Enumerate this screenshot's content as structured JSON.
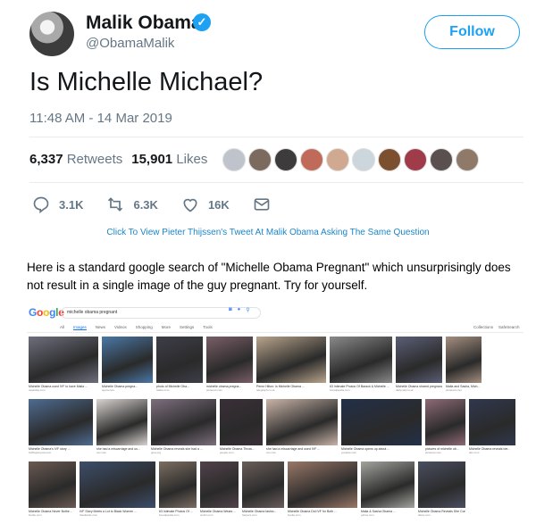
{
  "tweet": {
    "name": "Malik Obama",
    "handle": "@ObamaMalik",
    "follow_label": "Follow",
    "text": "Is Michelle Michael?",
    "timestamp": "11:48 AM - 14 Mar 2019",
    "retweets_count": "6,337",
    "retweets_label": "Retweets",
    "likes_count": "15,901",
    "likes_label": "Likes",
    "replies": "3.1K",
    "retweets_short": "6.3K",
    "likes_short": "16K"
  },
  "click_note": "Click To View Pieter Thijssen's Tweet At Malik Obama Asking The Same Question",
  "body_text": "Here is a standard google search of \"Michelle Obama Pregnant\" which unsurprisingly does not result in a single image of the guy pregnant. Try for yourself.",
  "google": {
    "logo": "Google",
    "query": "michelle obama pregnant",
    "tabs": [
      "All",
      "Images",
      "News",
      "Videos",
      "Shopping",
      "More",
      "Settings",
      "Tools"
    ],
    "right_links": [
      "Collections",
      "SafeSearch"
    ],
    "rows": [
      [
        {
          "caption": "Michelle Obama used IVF to have Malia ...",
          "source": "usatoday.com",
          "color": "#6d6f7d"
        },
        {
          "caption": "Michelle Obama pregna...",
          "source": "quora.com",
          "color": "#4a78a6"
        },
        {
          "caption": "photo of Michelle Oba...",
          "source": "twitter.com",
          "color": "#3e3e4a"
        },
        {
          "caption": "michelle obama pregna...",
          "source": "pinterest.com",
          "color": "#7a5f68"
        },
        {
          "caption": "Perez Hilton: Is Michelle Obama ...",
          "source": "telegraph.co.uk",
          "color": "#b9a58c"
        },
        {
          "caption": "63 Intimate Photos Of Barack & Michelle ...",
          "source": "boredpanda.com",
          "color": "#8a8a8a"
        },
        {
          "caption": "Michelle Obama shared pregnancy tips ...",
          "source": "dailymail.co.uk",
          "color": "#5b5f77"
        },
        {
          "caption": "Malia and Sasha, Mich...",
          "source": "pinterest.com",
          "color": "#a58f80"
        }
      ],
      [
        {
          "caption": "Michelle Obama's IVF story ...",
          "source": "huffingtonpost.com",
          "color": "#4f6c92"
        },
        {
          "caption": "she had a miscarriage and us...",
          "source": "vox.com",
          "color": "#d8d3d0"
        },
        {
          "caption": "Michelle Obama reveals she had a ...",
          "source": "gma.org",
          "color": "#7d6f7e"
        },
        {
          "caption": "Michelle Obama Throw...",
          "source": "people.com",
          "color": "#3a2f38"
        },
        {
          "caption": "she had a miscarriage and used IVF ...",
          "source": "vox.com",
          "color": "#c9b4a8"
        },
        {
          "caption": "Michelle Obama opens up about ...",
          "source": "youtube.com",
          "color": "#223049"
        },
        {
          "caption": "pictures of michelle ob...",
          "source": "pinterest.com",
          "color": "#8e6a76"
        },
        {
          "caption": "Michelle Obama reveals ber...",
          "source": "abc.com",
          "color": "#30384f"
        }
      ],
      [
        {
          "caption": "Michelle Obama Never Bothe...",
          "source": "bustle.com",
          "color": "#6b5a52"
        },
        {
          "caption": "IVF Story Meets a Lot to Black Women ...",
          "source": "theatlantic.com",
          "color": "#3c4e6a"
        },
        {
          "caption": "63 Intimate Photos Of ...",
          "source": "boredpanda.com",
          "color": "#7c6e62"
        },
        {
          "caption": "Michelle Obama Wears ...",
          "source": "wmbz.com",
          "color": "#52424a"
        },
        {
          "caption": "Michelle Obama fashio...",
          "source": "harpers.com",
          "color": "#6a5e5a"
        },
        {
          "caption": "Michelle Obama Did IVF for Both ...",
          "source": "bustle.com",
          "color": "#9a7868"
        },
        {
          "caption": "Malia & Sasha Obama ...",
          "source": "yahoo.com",
          "color": "#a3a39e"
        },
        {
          "caption": "Michelle Obama Reveals She Conceived ...",
          "source": "allure.com",
          "color": "#4a4f60"
        }
      ]
    ]
  }
}
